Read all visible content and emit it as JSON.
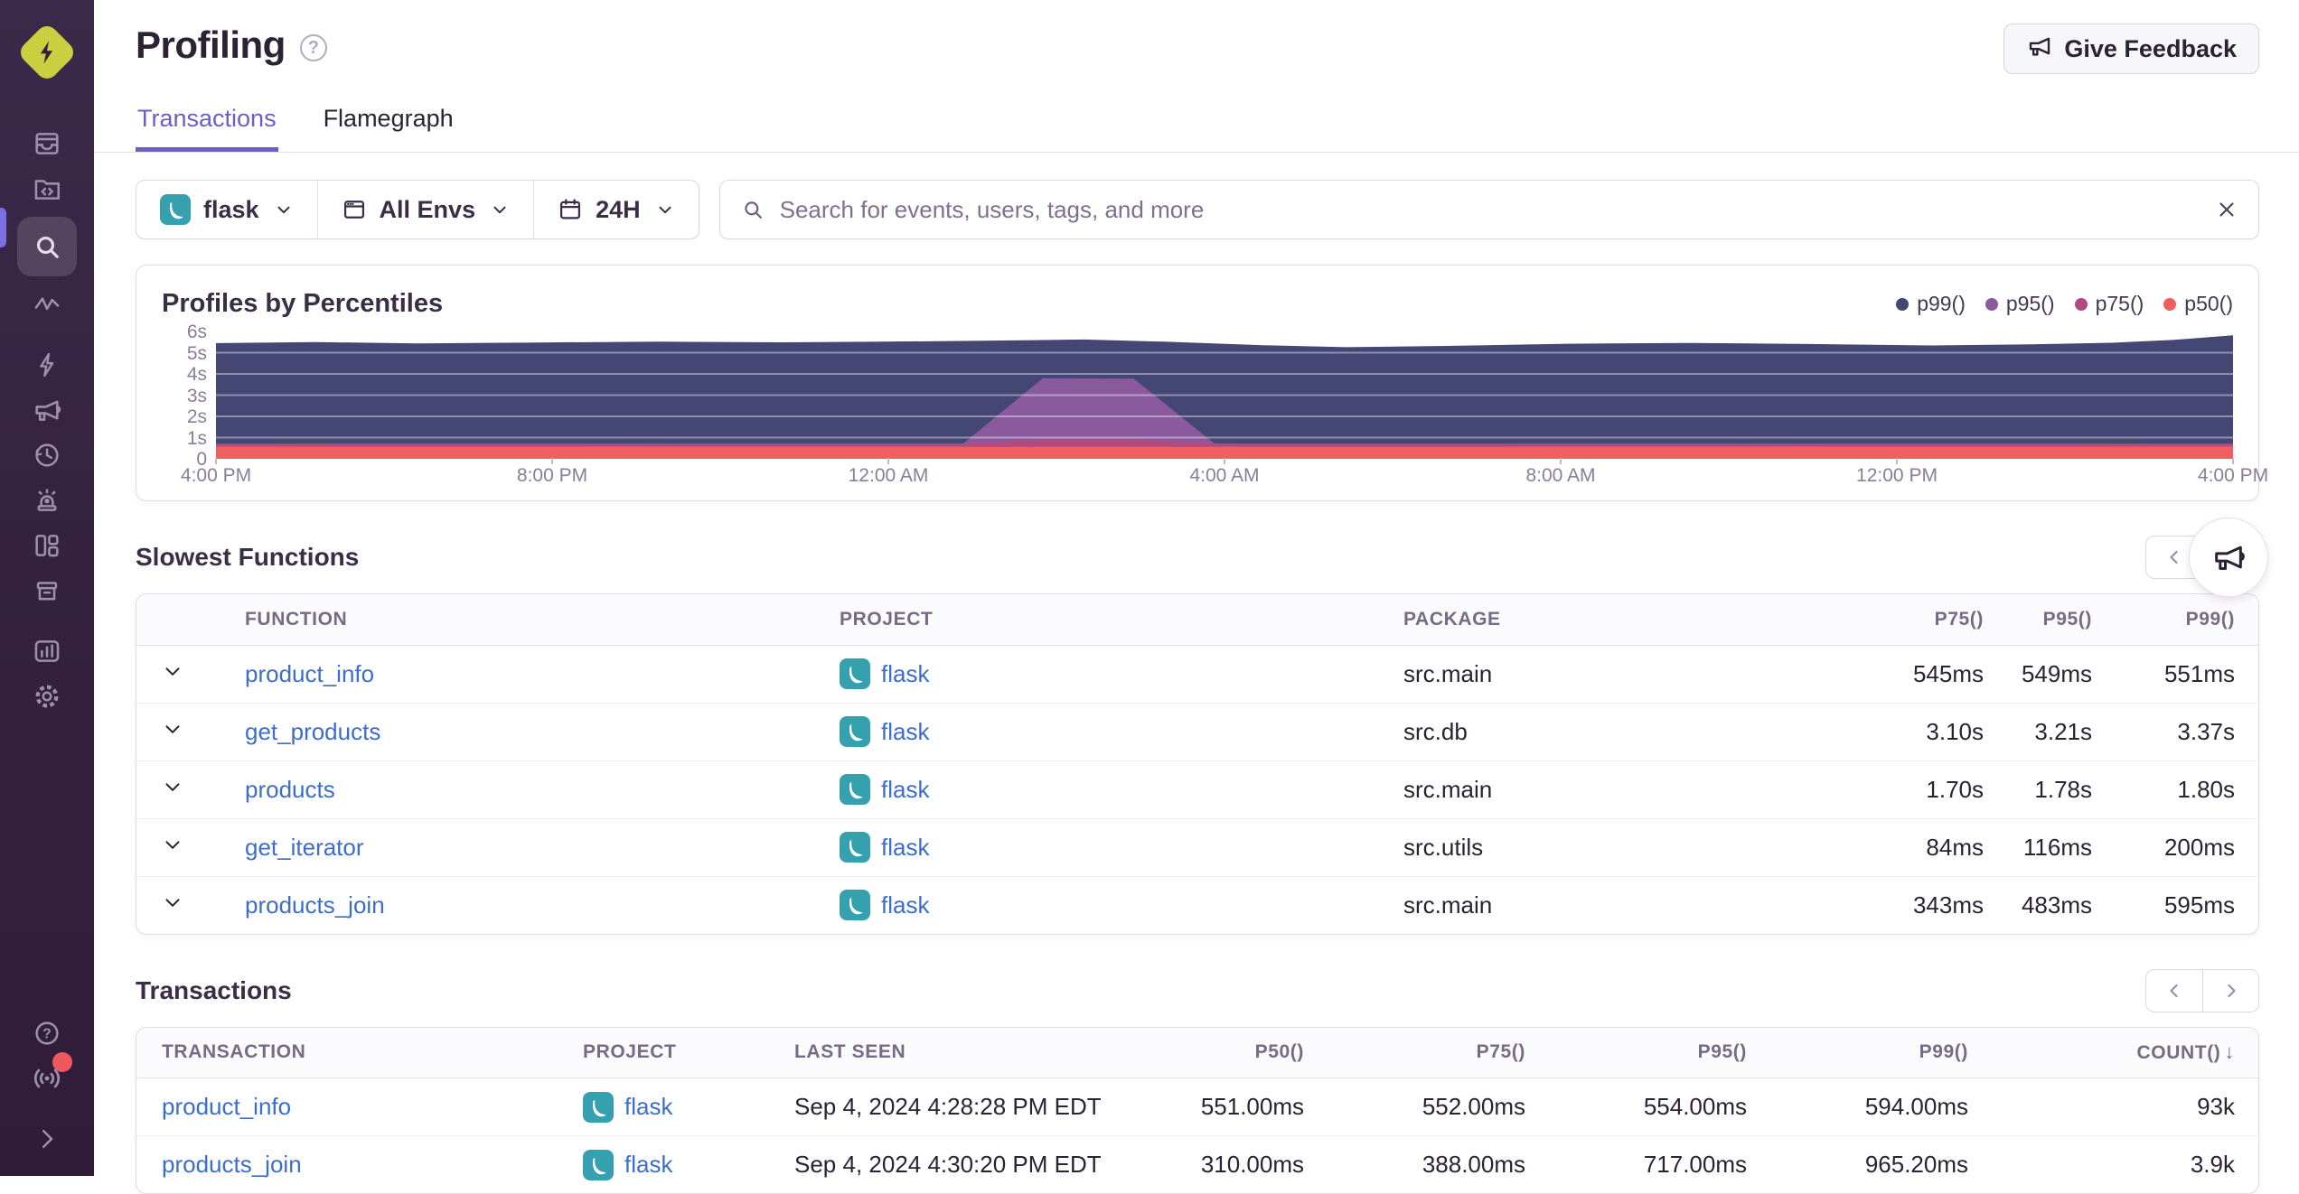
{
  "colors": {
    "accent_purple": "#6a5fc8",
    "link_blue": "#3b6ecc",
    "flask_teal": "#35a0ae",
    "sidebar_bg": "#32203e",
    "logo_lime": "#c9cf3f",
    "notification_red": "#f1575e"
  },
  "sidebar": {
    "items": [
      {
        "icon": "inbox-icon"
      },
      {
        "icon": "folder-code-icon"
      },
      {
        "icon": "search-icon",
        "active": true
      },
      {
        "icon": "zigzag-trace-icon"
      },
      {
        "icon": "lightning-icon"
      },
      {
        "icon": "megaphone-icon"
      },
      {
        "icon": "replay-clock-icon"
      },
      {
        "icon": "alerts-siren-icon"
      },
      {
        "icon": "dashboard-layout-icon"
      },
      {
        "icon": "archive-box-icon"
      },
      {
        "icon": "stats-chart-icon"
      },
      {
        "icon": "gear-icon"
      },
      {
        "icon": "help-icon"
      },
      {
        "icon": "broadcast-icon",
        "badge": true
      },
      {
        "icon": "expand-chevron-icon"
      }
    ]
  },
  "header": {
    "title": "Profiling",
    "feedback_label": "Give Feedback"
  },
  "tabs": [
    {
      "label": "Transactions",
      "active": true
    },
    {
      "label": "Flamegraph",
      "active": false
    }
  ],
  "filters": {
    "project": "flask",
    "environment": "All Envs",
    "date_range": "24H"
  },
  "search": {
    "placeholder": "Search for events, users, tags, and more"
  },
  "chart_data": {
    "type": "area",
    "title": "Profiles by Percentiles",
    "x_ticks": [
      "4:00 PM",
      "8:00 PM",
      "12:00 AM",
      "4:00 AM",
      "8:00 AM",
      "12:00 PM",
      "4:00 PM"
    ],
    "y_ticks": [
      "6s",
      "5s",
      "4s",
      "3s",
      "2s",
      "1s",
      "0"
    ],
    "y_max": 6,
    "y_unit": "seconds",
    "grid": true,
    "legend_position": "top-right",
    "series": [
      {
        "name": "p99()",
        "color": "#444674",
        "points": [
          [
            0,
            5.45
          ],
          [
            0.05,
            5.5
          ],
          [
            0.1,
            5.44
          ],
          [
            0.16,
            5.48
          ],
          [
            0.22,
            5.52
          ],
          [
            0.28,
            5.49
          ],
          [
            0.33,
            5.52
          ],
          [
            0.38,
            5.56
          ],
          [
            0.43,
            5.62
          ],
          [
            0.47,
            5.52
          ],
          [
            0.52,
            5.35
          ],
          [
            0.56,
            5.26
          ],
          [
            0.61,
            5.32
          ],
          [
            0.67,
            5.42
          ],
          [
            0.73,
            5.46
          ],
          [
            0.79,
            5.41
          ],
          [
            0.85,
            5.34
          ],
          [
            0.9,
            5.39
          ],
          [
            0.94,
            5.47
          ],
          [
            0.97,
            5.6
          ],
          [
            1,
            5.82
          ]
        ]
      },
      {
        "name": "p95()",
        "color": "#8b5a9e",
        "points": [
          [
            0,
            0.68
          ],
          [
            0.37,
            0.68
          ],
          [
            0.41,
            3.8
          ],
          [
            0.455,
            3.78
          ],
          [
            0.495,
            0.72
          ],
          [
            0.53,
            0.68
          ],
          [
            1,
            0.68
          ]
        ]
      },
      {
        "name": "p75()",
        "color": "#b34a7f",
        "points": [
          [
            0,
            0.72
          ],
          [
            0.37,
            0.72
          ],
          [
            0.41,
            0.9
          ],
          [
            0.455,
            0.9
          ],
          [
            0.5,
            0.72
          ],
          [
            1,
            0.72
          ]
        ]
      },
      {
        "name": "p50()",
        "color": "#f05e60",
        "points": [
          [
            0,
            0.58
          ],
          [
            0.25,
            0.57
          ],
          [
            0.5,
            0.56
          ],
          [
            0.75,
            0.57
          ],
          [
            1,
            0.58
          ]
        ]
      }
    ]
  },
  "slowest_functions": {
    "title": "Slowest Functions",
    "columns": [
      "FUNCTION",
      "PROJECT",
      "PACKAGE",
      "P75()",
      "P95()",
      "P99()"
    ],
    "rows": [
      {
        "function": "product_info",
        "project": "flask",
        "package": "src.main",
        "p75": "545ms",
        "p95": "549ms",
        "p99": "551ms"
      },
      {
        "function": "get_products",
        "project": "flask",
        "package": "src.db",
        "p75": "3.10s",
        "p95": "3.21s",
        "p99": "3.37s"
      },
      {
        "function": "products",
        "project": "flask",
        "package": "src.main",
        "p75": "1.70s",
        "p95": "1.78s",
        "p99": "1.80s"
      },
      {
        "function": "get_iterator",
        "project": "flask",
        "package": "src.utils",
        "p75": "84ms",
        "p95": "116ms",
        "p99": "200ms"
      },
      {
        "function": "products_join",
        "project": "flask",
        "package": "src.main",
        "p75": "343ms",
        "p95": "483ms",
        "p99": "595ms"
      }
    ]
  },
  "transactions": {
    "title": "Transactions",
    "columns": [
      "TRANSACTION",
      "PROJECT",
      "LAST SEEN",
      "P50()",
      "P75()",
      "P95()",
      "P99()",
      "COUNT()"
    ],
    "sort": {
      "column": "COUNT()",
      "direction": "desc",
      "arrow": "↓"
    },
    "rows": [
      {
        "transaction": "product_info",
        "project": "flask",
        "last_seen": "Sep 4, 2024 4:28:28 PM EDT",
        "p50": "551.00ms",
        "p75": "552.00ms",
        "p95": "554.00ms",
        "p99": "594.00ms",
        "count": "93k"
      },
      {
        "transaction": "products_join",
        "project": "flask",
        "last_seen": "Sep 4, 2024 4:30:20 PM EDT",
        "p50": "310.00ms",
        "p75": "388.00ms",
        "p95": "717.00ms",
        "p99": "965.20ms",
        "count": "3.9k"
      }
    ]
  }
}
